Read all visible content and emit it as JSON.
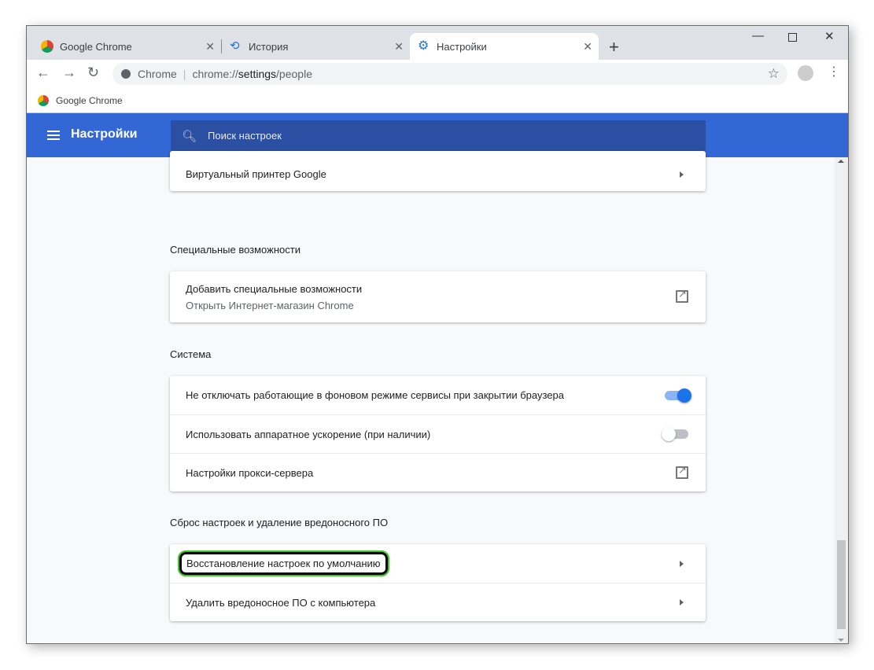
{
  "tabs": [
    {
      "label": "Google Chrome",
      "icon": "chrome-icon"
    },
    {
      "label": "История",
      "icon": "history-icon"
    },
    {
      "label": "Настройки",
      "icon": "gear-icon",
      "active": true
    }
  ],
  "address": {
    "site": "Chrome",
    "url_prefix": "chrome://",
    "url_host": "settings",
    "url_path": "/people"
  },
  "bookmarks": [
    {
      "label": "Google Chrome"
    }
  ],
  "header": {
    "title": "Настройки",
    "search_placeholder": "Поиск настроек"
  },
  "sections": {
    "printer": {
      "item": "Виртуальный принтер Google"
    },
    "accessibility": {
      "title": "Специальные возможности",
      "item": "Добавить специальные возможности",
      "sub": "Открыть Интернет-магазин Chrome"
    },
    "system": {
      "title": "Система",
      "items": [
        "Не отключать работающие в фоновом режиме сервисы при закрытии браузера",
        "Использовать аппаратное ускорение (при наличии)",
        "Настройки прокси-сервера"
      ],
      "toggles": [
        true,
        false
      ]
    },
    "reset": {
      "title": "Сброс настроек и удаление вредоносного ПО",
      "items": [
        "Восстановление настроек по умолчанию",
        "Удалить вредоносное ПО с компьютера"
      ]
    }
  },
  "colors": {
    "accent": "#3367d6",
    "toggle_on": "#1a73e8",
    "highlight": "#3ec42b"
  }
}
